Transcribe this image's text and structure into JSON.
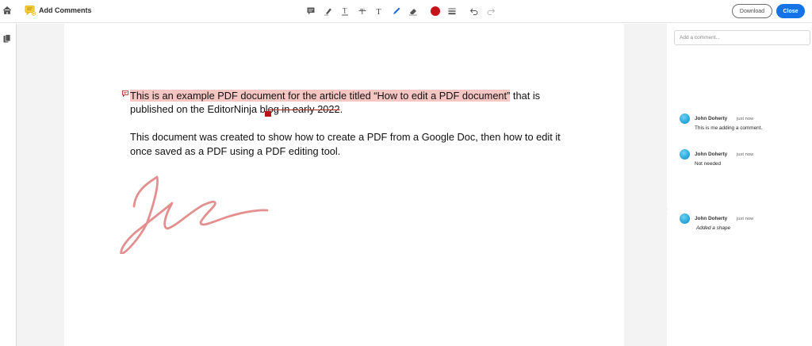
{
  "toolbar": {
    "title": "Add Comments",
    "download_label": "Download",
    "close_label": "Close",
    "tools": [
      "sticky-note-icon",
      "highlight-icon",
      "underline-text-icon",
      "strikethrough-text-icon",
      "add-text-icon",
      "draw-pen-icon",
      "eraser-icon",
      "color-picker",
      "line-weight-icon",
      "undo-icon",
      "redo-icon"
    ],
    "active_color": "#c5141a",
    "accent_color": "#1473e6"
  },
  "document": {
    "line1_highlighted": "This is an example PDF document for the article titled “How to edit a PDF document”",
    "line1_rest": " that is",
    "line2_before": "published on the EditorNinja b",
    "line2_caret_char": "l",
    "line2_struck_a": "og",
    "line2_struck_b": " in early 2022",
    "line2_end": ".",
    "line3": "This document was created to show how to create a PDF from a Google Doc, then how to edit it",
    "line4": "once saved as a PDF using a PDF editing tool.",
    "annotation_color": "#e48f8f"
  },
  "panel": {
    "comment_placeholder": "Add a comment...",
    "comments": [
      {
        "author": "John Doherty",
        "time": "just now",
        "text": "This is me adding a comment."
      },
      {
        "author": "John Doherty",
        "time": "just now",
        "text": "Not needed"
      },
      {
        "author": "John Doherty",
        "time": "just now",
        "text": "Added a shape"
      }
    ]
  }
}
